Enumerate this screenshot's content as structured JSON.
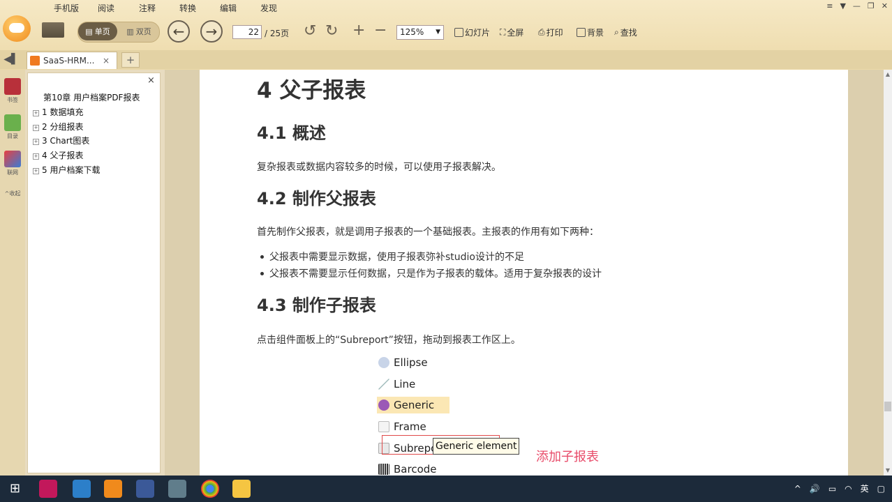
{
  "menu": [
    "手机版",
    "阅读",
    "注释",
    "转换",
    "编辑",
    "发现"
  ],
  "toolbar": {
    "single_label": "单页",
    "double_label": "双页",
    "page_current": "22",
    "page_total": "/ 25页",
    "zoom": "125%",
    "slideshow": "幻灯片",
    "fullscreen": "全屏",
    "print": "打印",
    "background": "背景",
    "find": "查找"
  },
  "tab": {
    "title": "SaaS-HRM...",
    "close": "×",
    "new": "+"
  },
  "sidebar": {
    "bookmarks": "书签",
    "toc": "目录",
    "mobile": "联网",
    "collapse": "收起"
  },
  "outline": {
    "close": "×",
    "items": [
      "第10章 用户档案PDF报表",
      "1 数据填充",
      "2 分组报表",
      "3 Chart图表",
      "4 父子报表",
      "5 用户档案下载"
    ]
  },
  "doc": {
    "h1": "4 父子报表",
    "h2_1": "4.1 概述",
    "p1": "复杂报表或数据内容较多的时候，可以使用子报表解决。",
    "h2_2": "4.2 制作父报表",
    "p2": "首先制作父报表，就是调用子报表的一个基础报表。主报表的作用有如下两种：",
    "bullets": [
      "父报表中需要显示数据，使用子报表弥补studio设计的不足",
      "父报表不需要显示任何数据，只是作为子报表的载体。适用于复杂报表的设计"
    ],
    "h2_3": "4.3 制作子报表",
    "p3": "点击组件面板上的“Subreport”按钮，拖动到报表工作区上。",
    "palette": [
      "Ellipse",
      "Line",
      "Generic",
      "Frame",
      "Subrepo",
      "Barcode"
    ],
    "tooltip": "Generic element",
    "annotation": "添加子报表"
  },
  "taskbar": {
    "ime": "英"
  },
  "colors": {
    "accent": "#f08a1c",
    "annotation": "#e84c6a",
    "taskbar": "#1c2a3a"
  }
}
